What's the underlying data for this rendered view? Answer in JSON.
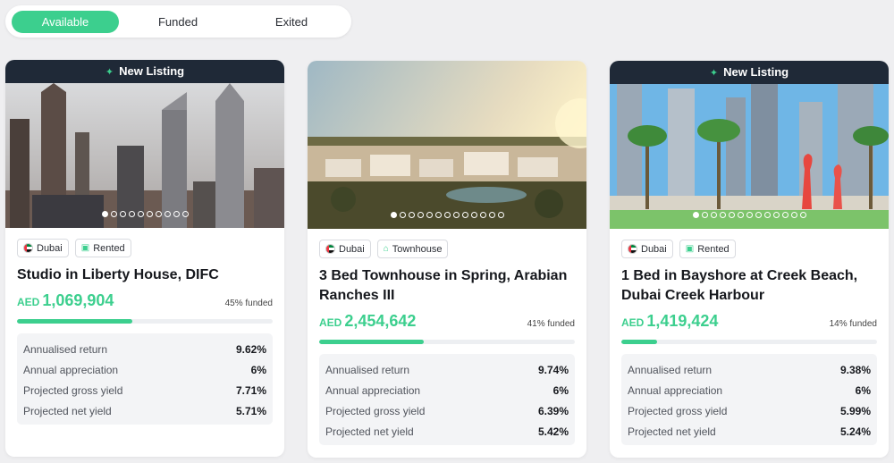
{
  "tabs": [
    {
      "label": "Available",
      "active": true
    },
    {
      "label": "Funded",
      "active": false
    },
    {
      "label": "Exited",
      "active": false
    }
  ],
  "colors": {
    "accent": "#3ccf8e",
    "banner": "#1f2937"
  },
  "listings": [
    {
      "banner": "New Listing",
      "photo": "dubai-skyline-difc",
      "dots_total": 10,
      "dots_active": 0,
      "chips": [
        {
          "label": "Dubai",
          "icon": "uae-flag-icon"
        },
        {
          "label": "Rented",
          "icon": "rented-icon"
        }
      ],
      "title": "Studio in Liberty House, DIFC",
      "currency": "AED",
      "price": "1,069,904",
      "funded_text": "45% funded",
      "funded_pct": 45,
      "stats": [
        {
          "label": "Annualised return",
          "value": "9.62%"
        },
        {
          "label": "Annual appreciation",
          "value": "6%"
        },
        {
          "label": "Projected gross yield",
          "value": "7.71%"
        },
        {
          "label": "Projected net yield",
          "value": "5.71%"
        }
      ]
    },
    {
      "banner": "",
      "photo": "townhouse-community-sunset",
      "dots_total": 13,
      "dots_active": 0,
      "chips": [
        {
          "label": "Dubai",
          "icon": "uae-flag-icon"
        },
        {
          "label": "Townhouse",
          "icon": "house-icon"
        }
      ],
      "title": "3 Bed Townhouse in Spring, Arabian Ranches III",
      "currency": "AED",
      "price": "2,454,642",
      "funded_text": "41% funded",
      "funded_pct": 41,
      "stats": [
        {
          "label": "Annualised return",
          "value": "9.74%"
        },
        {
          "label": "Annual appreciation",
          "value": "6%"
        },
        {
          "label": "Projected gross yield",
          "value": "6.39%"
        },
        {
          "label": "Projected net yield",
          "value": "5.42%"
        }
      ]
    },
    {
      "banner": "New Listing",
      "photo": "creek-harbour-towers-palms",
      "dots_total": 13,
      "dots_active": 0,
      "chips": [
        {
          "label": "Dubai",
          "icon": "uae-flag-icon"
        },
        {
          "label": "Rented",
          "icon": "rented-icon"
        }
      ],
      "title": "1 Bed in Bayshore at Creek Beach, Dubai Creek Harbour",
      "currency": "AED",
      "price": "1,419,424",
      "funded_text": "14% funded",
      "funded_pct": 14,
      "stats": [
        {
          "label": "Annualised return",
          "value": "9.38%"
        },
        {
          "label": "Annual appreciation",
          "value": "6%"
        },
        {
          "label": "Projected gross yield",
          "value": "5.99%"
        },
        {
          "label": "Projected net yield",
          "value": "5.24%"
        }
      ]
    }
  ]
}
